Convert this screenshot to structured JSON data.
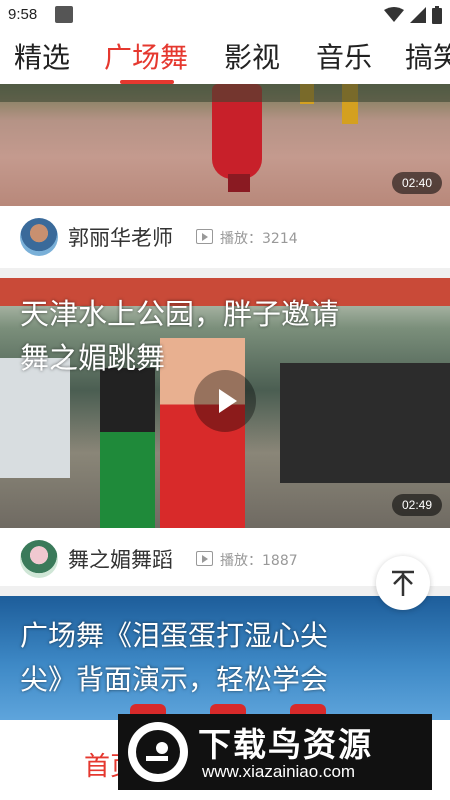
{
  "status_bar": {
    "time": "9:58"
  },
  "tabs": [
    {
      "label": "精选"
    },
    {
      "label": "广场舞"
    },
    {
      "label": "影视"
    },
    {
      "label": "音乐"
    },
    {
      "label": "搞笑"
    }
  ],
  "feed": {
    "videos": [
      {
        "title": "",
        "duration": "02:40",
        "author": "郭丽华老师",
        "plays": "播放：3214"
      },
      {
        "title_line1": "天津水上公园，胖子邀请",
        "title_line2": "舞之媚跳舞",
        "duration": "02:49",
        "author": "舞之媚舞蹈",
        "plays": "播放：1887"
      },
      {
        "title_line1": "广场舞《泪蛋蛋打湿心尖",
        "title_line2": "尖》背面演示，轻松学会"
      }
    ]
  },
  "bottom_nav": {
    "home": "首页"
  },
  "watermark": {
    "title": "下载鸟资源",
    "url": "www.xiazainiao.com"
  },
  "colors": {
    "accent": "#e5382f"
  }
}
